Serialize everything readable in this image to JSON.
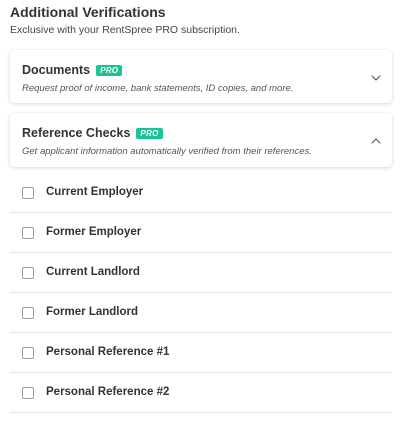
{
  "section": {
    "title": "Additional Verifications",
    "subtitle": "Exclusive with your RentSpree PRO subscription."
  },
  "cards": {
    "documents": {
      "title": "Documents",
      "badge": "PRO",
      "description": "Request proof of income, bank statements, ID copies, and more.",
      "expanded": false
    },
    "references": {
      "title": "Reference Checks",
      "badge": "PRO",
      "description": "Get applicant information automatically verified from their references.",
      "expanded": true
    }
  },
  "reference_options": [
    {
      "label": "Current Employer",
      "checked": false
    },
    {
      "label": "Former Employer",
      "checked": false
    },
    {
      "label": "Current Landlord",
      "checked": false
    },
    {
      "label": "Former Landlord",
      "checked": false
    },
    {
      "label": "Personal Reference #1",
      "checked": false
    },
    {
      "label": "Personal Reference #2",
      "checked": false
    }
  ],
  "colors": {
    "pro_badge": "#1bc496",
    "text": "#333333",
    "divider": "#e4e4e4"
  },
  "icons": {
    "documents_toggle": "chevron-down-icon",
    "references_toggle": "chevron-up-icon"
  }
}
